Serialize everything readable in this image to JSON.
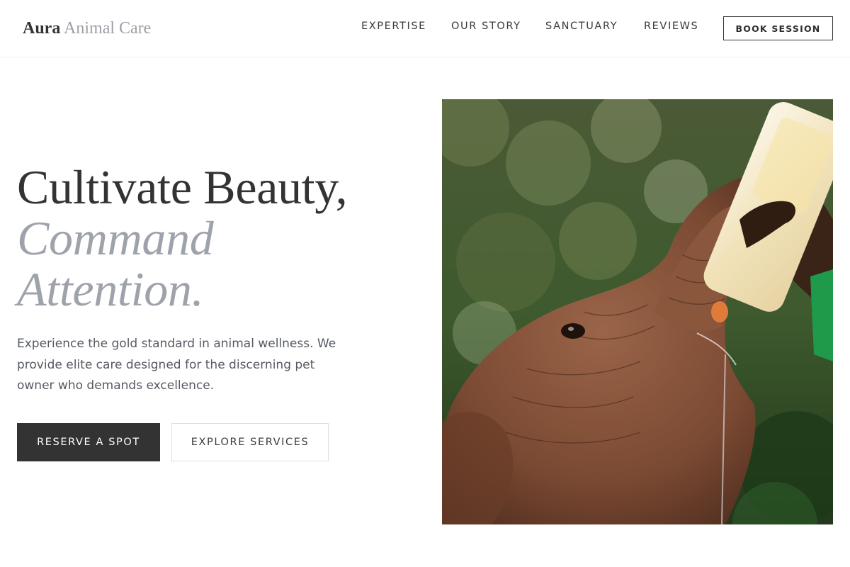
{
  "brand": {
    "name_strong": "Aura",
    "name_light": "Animal Care"
  },
  "nav": {
    "items": [
      {
        "label": "EXPERTISE"
      },
      {
        "label": "OUR STORY"
      },
      {
        "label": "SANCTUARY"
      },
      {
        "label": "REVIEWS"
      }
    ],
    "cta_label": "BOOK SESSION"
  },
  "hero": {
    "title_line1": "Cultivate Beauty,",
    "title_line2": "Command",
    "title_line3": "Attention.",
    "description": "Experience the gold standard in animal wellness. We provide elite care designed for the discerning pet owner who demands excellence.",
    "primary_button": "RESERVE A SPOT",
    "secondary_button": "EXPLORE SERVICES"
  },
  "colors": {
    "text_dark": "#333333",
    "accent_gray": "#9ea2ab",
    "body_text": "#555a62",
    "button_dark": "#333333",
    "border_light": "#ececec"
  },
  "image": {
    "subject": "baby elephant drinking from a milk bottle held by a caretaker"
  }
}
